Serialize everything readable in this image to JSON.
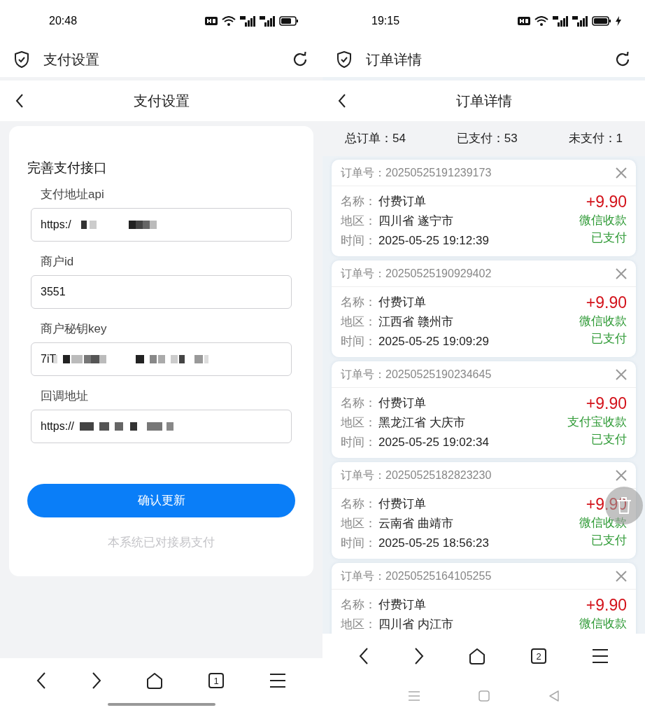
{
  "left_screen": {
    "status_bar": {
      "time": "20:48",
      "charging": false
    },
    "app_bar": {
      "title": "支付设置"
    },
    "header": {
      "title": "支付设置"
    },
    "form": {
      "title": "完善支付接口",
      "fields": [
        {
          "label": "支付地址api",
          "value": "https:/"
        },
        {
          "label": "商户id",
          "value": "3551"
        },
        {
          "label": "商户秘钥key",
          "value": "7iT"
        },
        {
          "label": "回调地址",
          "value": "https://"
        }
      ],
      "submit": "确认更新",
      "note": "本系统已对接易支付"
    },
    "bottom_nav": {
      "tab_count": "1",
      "kind": "gesture"
    }
  },
  "right_screen": {
    "status_bar": {
      "time": "19:15",
      "charging": true
    },
    "app_bar": {
      "title": "订单详情"
    },
    "header": {
      "title": "订单详情"
    },
    "stats": [
      {
        "label": "总订单：",
        "value": "54"
      },
      {
        "label": "已支付：",
        "value": "53"
      },
      {
        "label": "未支付：",
        "value": "1"
      }
    ],
    "orders": [
      {
        "order_label": "订单号：",
        "order_no": "20250525191239173",
        "rows": [
          {
            "label": "名称：",
            "value": "付费订单"
          },
          {
            "label": "地区：",
            "value": "四川省 遂宁市"
          },
          {
            "label": "时间：",
            "value": "2025-05-25 19:12:39"
          }
        ],
        "amount": "+9.90",
        "method": "微信收款",
        "status": "已支付"
      },
      {
        "order_label": "订单号：",
        "order_no": "20250525190929402",
        "rows": [
          {
            "label": "名称：",
            "value": "付费订单"
          },
          {
            "label": "地区：",
            "value": "江西省 赣州市"
          },
          {
            "label": "时间：",
            "value": "2025-05-25 19:09:29"
          }
        ],
        "amount": "+9.90",
        "method": "微信收款",
        "status": "已支付"
      },
      {
        "order_label": "订单号：",
        "order_no": "20250525190234645",
        "rows": [
          {
            "label": "名称：",
            "value": "付费订单"
          },
          {
            "label": "地区：",
            "value": "黑龙江省 大庆市"
          },
          {
            "label": "时间：",
            "value": "2025-05-25 19:02:34"
          }
        ],
        "amount": "+9.90",
        "method": "支付宝收款",
        "status": "已支付"
      },
      {
        "order_label": "订单号：",
        "order_no": "20250525182823230",
        "rows": [
          {
            "label": "名称：",
            "value": "付费订单"
          },
          {
            "label": "地区：",
            "value": "云南省 曲靖市"
          },
          {
            "label": "时间：",
            "value": "2025-05-25 18:56:23"
          }
        ],
        "amount": "+9.90",
        "method": "微信收款",
        "status": "已支付"
      },
      {
        "order_label": "订单号：",
        "order_no": "20250525164105255",
        "rows": [
          {
            "label": "名称：",
            "value": "付费订单"
          },
          {
            "label": "地区：",
            "value": "四川省 内江市"
          }
        ],
        "amount": "+9.90",
        "method": "微信收款"
      }
    ],
    "bottom_nav": {
      "tab_count": "2",
      "kind": "buttons"
    }
  }
}
